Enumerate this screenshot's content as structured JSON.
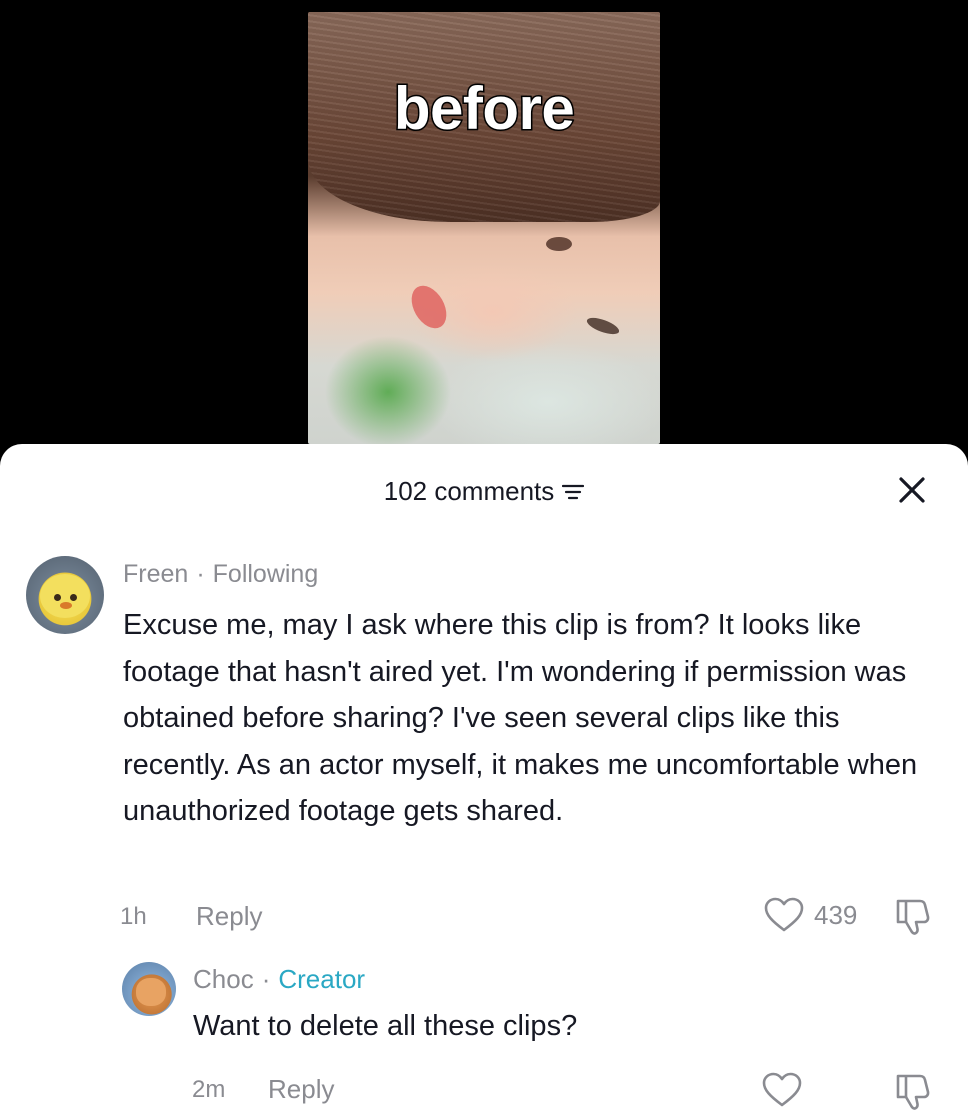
{
  "video": {
    "overlay_text": "before"
  },
  "header": {
    "comment_count": "102 comments"
  },
  "comment": {
    "author": "Freen",
    "relation": "Following",
    "text": "Excuse me, may I ask where this clip is from? It looks like footage that hasn't aired yet. I'm wondering if permission was obtained before sharing? I've seen several clips like this recently. As an actor myself, it makes me uncomfortable when unauthorized footage gets shared.",
    "time": "1h",
    "reply_label": "Reply",
    "likes": "439"
  },
  "reply": {
    "author": "Choc",
    "badge": "Creator",
    "text": "Want to delete all these clips?",
    "time": "2m",
    "reply_label": "Reply"
  },
  "colors": {
    "creator_badge": "#2aa8c4",
    "meta_gray": "#8a8b91",
    "text_dark": "#161823"
  },
  "icons": [
    "filter-icon",
    "close-icon",
    "heart-icon",
    "dislike-icon"
  ]
}
